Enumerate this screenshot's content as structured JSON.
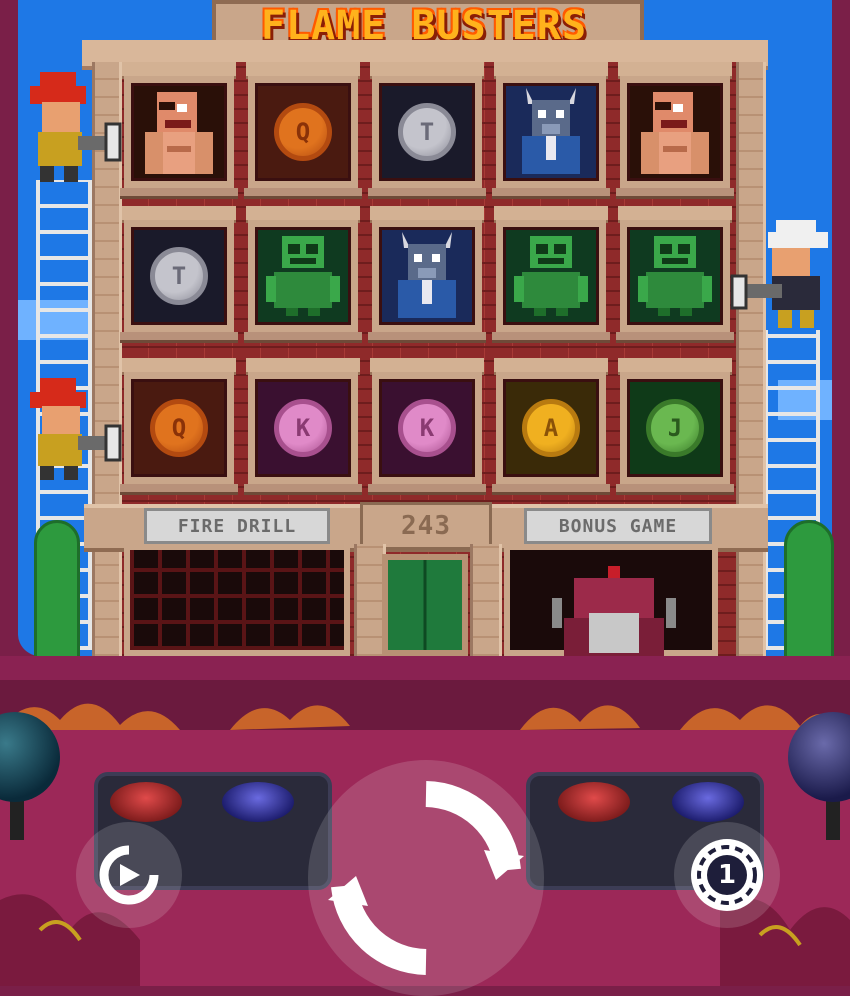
{
  "game": {
    "title": "FLAME BUSTERS",
    "labels": {
      "fire_drill": "FIRE DRILL",
      "ways": "243",
      "bonus_game": "BONUS GAME"
    }
  },
  "reels": [
    [
      {
        "symbol": "pirate-brute",
        "icon": "pirate-brute-icon"
      },
      {
        "symbol": "coin-T",
        "letter": "T",
        "icon": "coin-t-icon"
      },
      {
        "symbol": "coin-Q",
        "letter": "Q",
        "icon": "coin-q-icon"
      }
    ],
    [
      {
        "symbol": "coin-Q",
        "letter": "Q",
        "icon": "coin-q-icon"
      },
      {
        "symbol": "robot",
        "icon": "robot-icon"
      },
      {
        "symbol": "coin-K",
        "letter": "K",
        "icon": "coin-k-icon"
      }
    ],
    [
      {
        "symbol": "coin-T",
        "letter": "T",
        "icon": "coin-t-icon"
      },
      {
        "symbol": "goat",
        "icon": "goat-icon"
      },
      {
        "symbol": "coin-K",
        "letter": "K",
        "icon": "coin-k-icon"
      }
    ],
    [
      {
        "symbol": "goat",
        "icon": "goat-icon"
      },
      {
        "symbol": "robot",
        "icon": "robot-icon"
      },
      {
        "symbol": "coin-A",
        "letter": "A",
        "icon": "coin-a-icon"
      }
    ],
    [
      {
        "symbol": "pirate-brute",
        "icon": "pirate-brute-icon"
      },
      {
        "symbol": "robot",
        "icon": "robot-icon"
      },
      {
        "symbol": "coin-J",
        "letter": "J",
        "icon": "coin-j-icon"
      }
    ]
  ],
  "symbol_colors": {
    "coin-Q": {
      "fill": "#e0731e",
      "ring": "#b34a10",
      "text": "#8a3208",
      "bg": "#4a1a10"
    },
    "coin-T": {
      "fill": "#c4c4cc",
      "ring": "#8a8a96",
      "text": "#6a6a78",
      "bg": "#1a1a2a"
    },
    "coin-K": {
      "fill": "#e08ac8",
      "ring": "#a8508e",
      "text": "#8a3a72",
      "bg": "#3a1030"
    },
    "coin-A": {
      "fill": "#f0b020",
      "ring": "#b87a10",
      "text": "#8a5208",
      "bg": "#3a2a08"
    },
    "coin-J": {
      "fill": "#6ab850",
      "ring": "#3a7a2a",
      "text": "#2a5a1e",
      "bg": "#0f3a18"
    },
    "robot": {
      "bg": "#0f3a20"
    },
    "goat": {
      "bg": "#1a2a5a"
    },
    "pirate-brute": {
      "bg": "#2a1008"
    }
  },
  "controls": {
    "autoplay": {
      "icon": "autoplay-icon"
    },
    "spin": {
      "icon": "spin-icon"
    },
    "bet": {
      "icon": "coin-stack-icon",
      "value": "1"
    }
  },
  "colors": {
    "sky": "#1e78e6",
    "brick": "#8f2a2a",
    "stone": "#c9a68a",
    "cabinet": "#9c2858"
  }
}
